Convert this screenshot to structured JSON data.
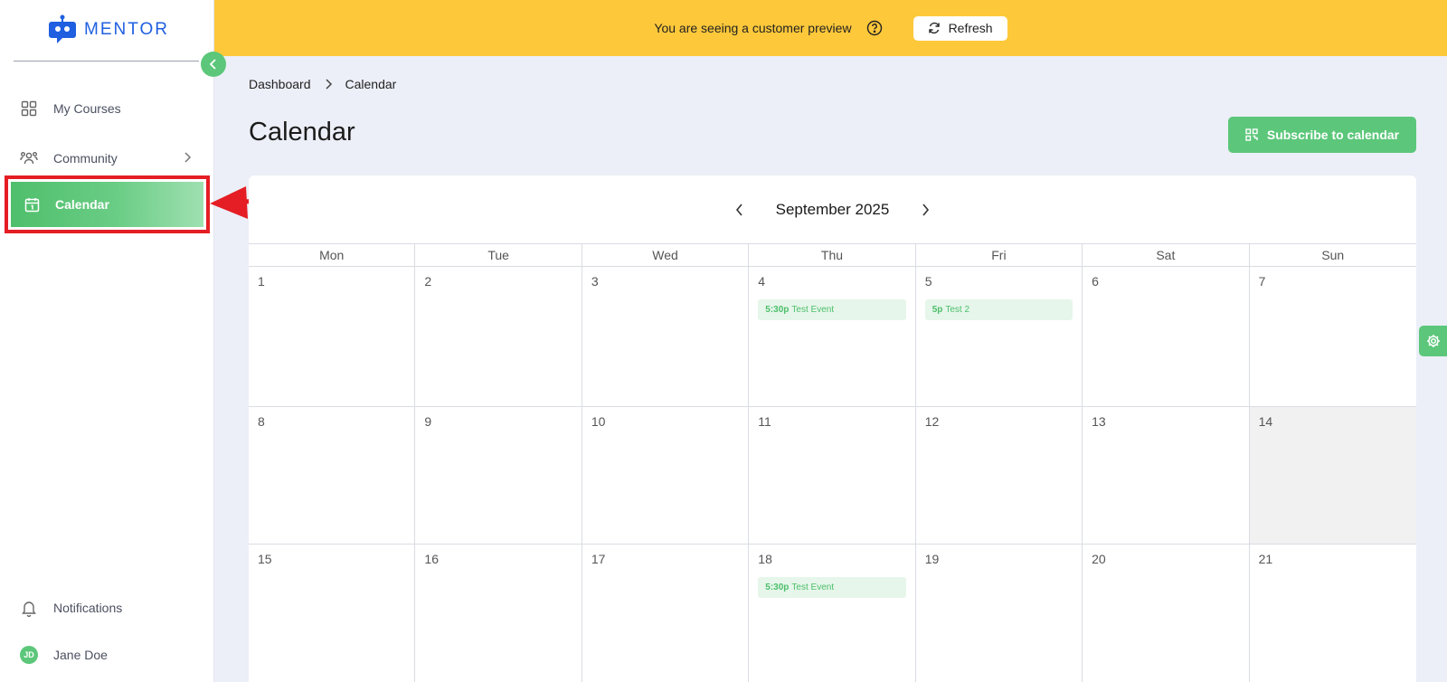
{
  "brand": {
    "name": "MENTOR",
    "color": "#1f5fe0",
    "icon": "robot-chat-icon"
  },
  "colors": {
    "accent": "#5cc77a",
    "banner": "#fdc83a",
    "highlight": "#e41e24"
  },
  "sidebar": {
    "items": [
      {
        "label": "My Courses",
        "icon": "grid-icon"
      },
      {
        "label": "Community",
        "icon": "people-icon"
      },
      {
        "label": "Calendar",
        "icon": "calendar-icon",
        "active": true
      }
    ],
    "footer": [
      {
        "label": "Notifications",
        "icon": "bell-icon"
      },
      {
        "label": "Jane Doe",
        "avatar_initials": "JD"
      }
    ]
  },
  "banner": {
    "text": "You are seeing a customer preview",
    "refresh_label": "Refresh"
  },
  "breadcrumb": {
    "root": "Dashboard",
    "current": "Calendar"
  },
  "page": {
    "title": "Calendar",
    "subscribe_label": "Subscribe to calendar"
  },
  "calendar": {
    "month": "September 2025",
    "weekdays": [
      "Mon",
      "Tue",
      "Wed",
      "Thu",
      "Fri",
      "Sat",
      "Sun"
    ],
    "weeks": [
      {
        "days": [
          {
            "num": "1"
          },
          {
            "num": "2"
          },
          {
            "num": "3"
          },
          {
            "num": "4",
            "events": [
              {
                "time": "5:30p",
                "title": "Test Event"
              }
            ]
          },
          {
            "num": "5",
            "events": [
              {
                "time": "5p",
                "title": "Test 2"
              }
            ]
          },
          {
            "num": "6"
          },
          {
            "num": "7"
          }
        ]
      },
      {
        "days": [
          {
            "num": "8"
          },
          {
            "num": "9"
          },
          {
            "num": "10"
          },
          {
            "num": "11"
          },
          {
            "num": "12"
          },
          {
            "num": "13"
          },
          {
            "num": "14",
            "shaded": true
          }
        ]
      },
      {
        "days": [
          {
            "num": "15"
          },
          {
            "num": "16"
          },
          {
            "num": "17"
          },
          {
            "num": "18",
            "events": [
              {
                "time": "5:30p",
                "title": "Test Event"
              }
            ]
          },
          {
            "num": "19"
          },
          {
            "num": "20"
          },
          {
            "num": "21"
          }
        ]
      }
    ]
  }
}
